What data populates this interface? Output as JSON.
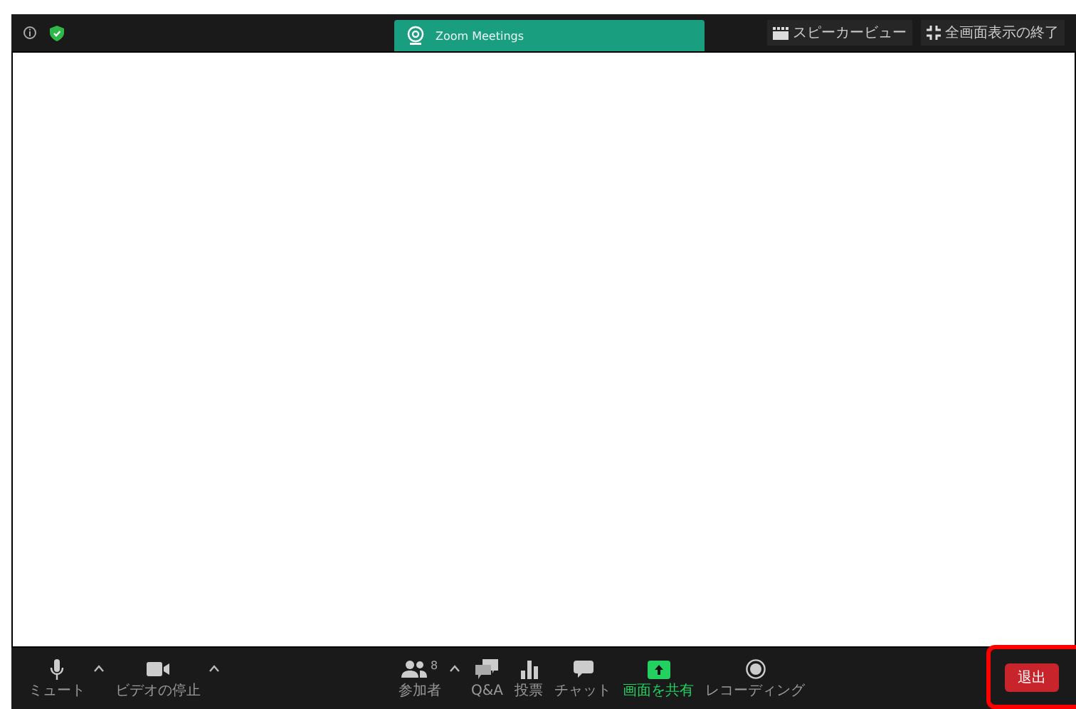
{
  "notification": {
    "title": "Zoom Meetings"
  },
  "top_buttons": [
    {
      "kind": "speaker",
      "label": "スピーカービュー"
    },
    {
      "kind": "exit-full",
      "label": "全画面表示の終了"
    }
  ],
  "toolbar": [
    {
      "kind": "mic",
      "label": "ミュート",
      "caret": true,
      "active": false
    },
    {
      "kind": "video",
      "label": "ビデオの停止",
      "caret": true,
      "active": false
    },
    {
      "kind": "participants",
      "label": "参加者",
      "count": "8",
      "caret": true,
      "active": false
    },
    {
      "kind": "qa",
      "label": "Q&A",
      "active": false
    },
    {
      "kind": "poll",
      "label": "投票",
      "active": false
    },
    {
      "kind": "chat",
      "label": "チャット",
      "active": false
    },
    {
      "kind": "share",
      "label": "画面を共有",
      "active": true
    },
    {
      "kind": "record",
      "label": "レコーディング",
      "active": false
    }
  ],
  "leave_button": {
    "label": "退出",
    "highlighted": true
  }
}
